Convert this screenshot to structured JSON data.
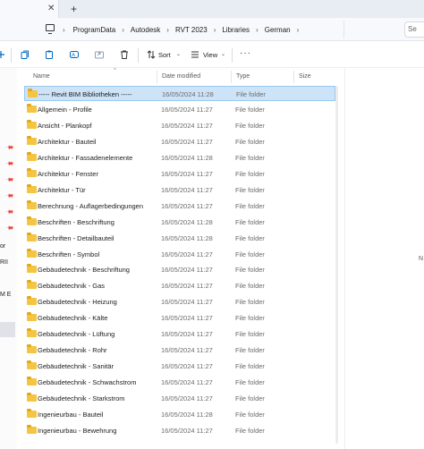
{
  "tabs": {
    "close_glyph": "✕",
    "add_glyph": "+"
  },
  "breadcrumb": {
    "separator": "›",
    "items": [
      "ProgramData",
      "Autodesk",
      "RVT 2023",
      "Libraries",
      "German"
    ]
  },
  "search": {
    "text": "Se"
  },
  "toolbar": {
    "sort_label": "Sort",
    "view_label": "View",
    "more_label": "···",
    "chevron": "⌄"
  },
  "nav_pane": {
    "fragments": [
      "or",
      "RII",
      "M E"
    ]
  },
  "columns": {
    "name": "Name",
    "date": "Date modified",
    "type": "Type",
    "size": "Size",
    "sort_indicator": "^"
  },
  "rows": [
    {
      "name": "----- Revit BIM Bibliotheken -----",
      "date": "16/05/2024 11:28",
      "type": "File folder"
    },
    {
      "name": "Allgemein - Profile",
      "date": "16/05/2024 11:27",
      "type": "File folder"
    },
    {
      "name": "Ansicht - Plankopf",
      "date": "16/05/2024 11:27",
      "type": "File folder"
    },
    {
      "name": "Architektur - Bauteil",
      "date": "16/05/2024 11:27",
      "type": "File folder"
    },
    {
      "name": "Architektur - Fassadenelemente",
      "date": "16/05/2024 11:28",
      "type": "File folder"
    },
    {
      "name": "Architektur - Fenster",
      "date": "16/05/2024 11:27",
      "type": "File folder"
    },
    {
      "name": "Architektur - Tür",
      "date": "16/05/2024 11:27",
      "type": "File folder"
    },
    {
      "name": "Berechnung - Auflagerbedingungen",
      "date": "16/05/2024 11:27",
      "type": "File folder"
    },
    {
      "name": "Beschriften - Beschriftung",
      "date": "16/05/2024 11:28",
      "type": "File folder"
    },
    {
      "name": "Beschriften - Detailbauteil",
      "date": "16/05/2024 11:28",
      "type": "File folder"
    },
    {
      "name": "Beschriften - Symbol",
      "date": "16/05/2024 11:27",
      "type": "File folder"
    },
    {
      "name": "Gebäudetechnik - Beschriftung",
      "date": "16/05/2024 11:27",
      "type": "File folder"
    },
    {
      "name": "Gebäudetechnik - Gas",
      "date": "16/05/2024 11:27",
      "type": "File folder"
    },
    {
      "name": "Gebäudetechnik - Heizung",
      "date": "16/05/2024 11:27",
      "type": "File folder"
    },
    {
      "name": "Gebäudetechnik - Kälte",
      "date": "16/05/2024 11:27",
      "type": "File folder"
    },
    {
      "name": "Gebäudetechnik - Lüftung",
      "date": "16/05/2024 11:27",
      "type": "File folder"
    },
    {
      "name": "Gebäudetechnik - Rohr",
      "date": "16/05/2024 11:27",
      "type": "File folder"
    },
    {
      "name": "Gebäudetechnik - Sanitär",
      "date": "16/05/2024 11:27",
      "type": "File folder"
    },
    {
      "name": "Gebäudetechnik - Schwachstrom",
      "date": "16/05/2024 11:27",
      "type": "File folder"
    },
    {
      "name": "Gebäudetechnik - Starkstrom",
      "date": "16/05/2024 11:27",
      "type": "File folder"
    },
    {
      "name": "Ingenieurbau - Bauteil",
      "date": "16/05/2024 11:28",
      "type": "File folder"
    },
    {
      "name": "Ingenieurbau - Bewehrung",
      "date": "16/05/2024 11:27",
      "type": "File folder"
    }
  ],
  "selected_row": 0,
  "details_pane": {
    "fragment": "N"
  },
  "colors": {
    "selection_bg": "#cde3f8",
    "selection_border": "#99c8f0",
    "folder": "#f4c542",
    "accent": "#0067c0"
  },
  "icons": {
    "toolbar": [
      "new-icon",
      "cut-icon",
      "copy-icon",
      "rename-icon",
      "share-icon",
      "delete-icon",
      "sort-icon",
      "view-icon",
      "more-icon"
    ],
    "nav": "pin-icon",
    "address": "this-pc-icon",
    "rows": "folder-icon"
  }
}
